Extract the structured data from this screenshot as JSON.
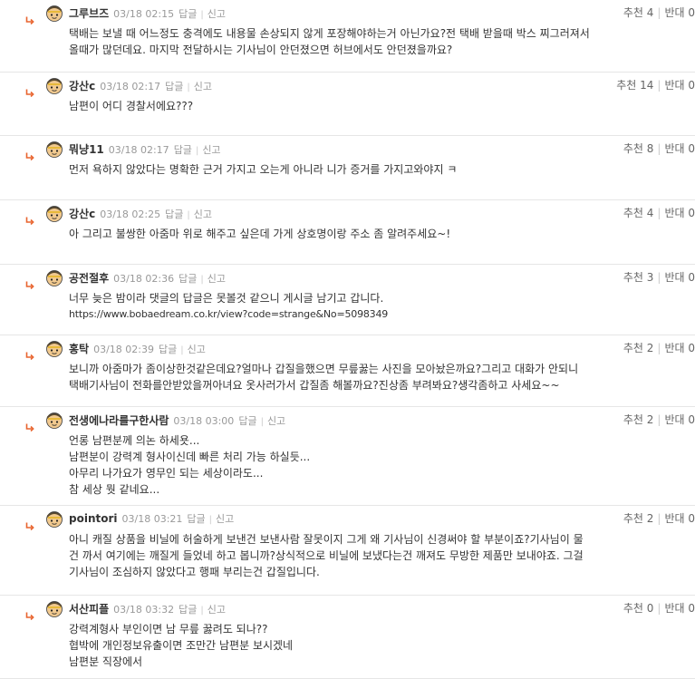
{
  "comments": [
    {
      "nick": "그루브즈",
      "date": "03/18 02:15",
      "reply": "답글",
      "report": "신고",
      "up_label": "추천",
      "up": "4",
      "down_label": "반대",
      "down": "0",
      "lines": [
        "택배는 보낼 때 어느정도 충격에도 내용물 손상되지 않게 포장해야하는거 아닌가요?전 택배 받을때 박스 찌그러져서",
        "올때가 많던데요. 마지막 전달하시는 기사님이 안던졌으면 허브에서도 안던졌을까요?"
      ]
    },
    {
      "nick": "강산c",
      "date": "03/18 02:17",
      "reply": "답글",
      "report": "신고",
      "up_label": "추천",
      "up": "14",
      "down_label": "반대",
      "down": "0",
      "lines": [
        "남편이 어디 경찰서에요???"
      ]
    },
    {
      "nick": "뭐냥11",
      "date": "03/18 02:17",
      "reply": "답글",
      "report": "신고",
      "up_label": "추천",
      "up": "8",
      "down_label": "반대",
      "down": "0",
      "lines": [
        "먼저 욕하지 않았다는 명확한 근거 가지고 오는게 아니라 니가 증거를 가지고와야지 ㅋ"
      ]
    },
    {
      "nick": "강산c",
      "date": "03/18 02:25",
      "reply": "답글",
      "report": "신고",
      "up_label": "추천",
      "up": "4",
      "down_label": "반대",
      "down": "0",
      "lines": [
        "아 그리고 불쌍한 아줌마 위로 해주고 싶은데 가게 상호명이랑 주소 좀 알려주세요~!"
      ]
    },
    {
      "nick": "공전절후",
      "date": "03/18 02:36",
      "reply": "답글",
      "report": "신고",
      "up_label": "추천",
      "up": "3",
      "down_label": "반대",
      "down": "0",
      "lines": [
        "너무 늦은 밤이라 댓글의 답글은 못볼것 같으니 게시글 남기고 갑니다.",
        "https://www.bobaedream.co.kr/view?code=strange&No=5098349"
      ]
    },
    {
      "nick": "홍탁",
      "date": "03/18 02:39",
      "reply": "답글",
      "report": "신고",
      "up_label": "추천",
      "up": "2",
      "down_label": "반대",
      "down": "0",
      "lines": [
        "보니까 아줌마가 좀이상한것같은데요?얼마나 갑질을했으면 무릎꿇는 사진을 모아놨은까요?그리고 대화가 안되니",
        "택배기사님이 전화를안받았을꺼아녀요 옷사러가서 갑질좀 해볼까요?진상좀 부려봐요?생각좀하고 사세요~~"
      ]
    },
    {
      "nick": "전생에나라를구한사람",
      "date": "03/18 03:00",
      "reply": "답글",
      "report": "신고",
      "up_label": "추천",
      "up": "2",
      "down_label": "반대",
      "down": "0",
      "lines": [
        "언롱 남편분께 의논 하세욧...",
        "남편분이 강력계 형사이신데 빠른 처리 가능 하실듯...",
        "아무리 나가요가 영무인 되는 세상이라도...",
        "참 세상 뭣 같네요..."
      ]
    },
    {
      "nick": "pointori",
      "date": "03/18 03:21",
      "reply": "답글",
      "report": "신고",
      "up_label": "추천",
      "up": "2",
      "down_label": "반대",
      "down": "0",
      "lines": [
        "아니 캐질 상품을 비닐에 허술하게 보낸건 보낸사람 잘못이지 그게 왜 기사님이 신경써야 할 부분이죠?기사님이 물",
        "건 까서 여기에는 깨질게 들었네 하고 봅니까?상식적으로 비닐에 보냈다는건 깨져도 무방한 제품만 보내야죠. 그걸",
        "기사님이 조심하지 않았다고 행패 부리는건 갑질입니다."
      ]
    },
    {
      "nick": "서산피플",
      "date": "03/18 03:32",
      "reply": "답글",
      "report": "신고",
      "up_label": "추천",
      "up": "0",
      "down_label": "반대",
      "down": "0",
      "lines": [
        "강력계형사 부인이면 남 무릎 꿇려도 되나??",
        "협박에 개인정보유출이면 조만간 남편분 보시겠네",
        "남편분 직장에서"
      ]
    }
  ]
}
